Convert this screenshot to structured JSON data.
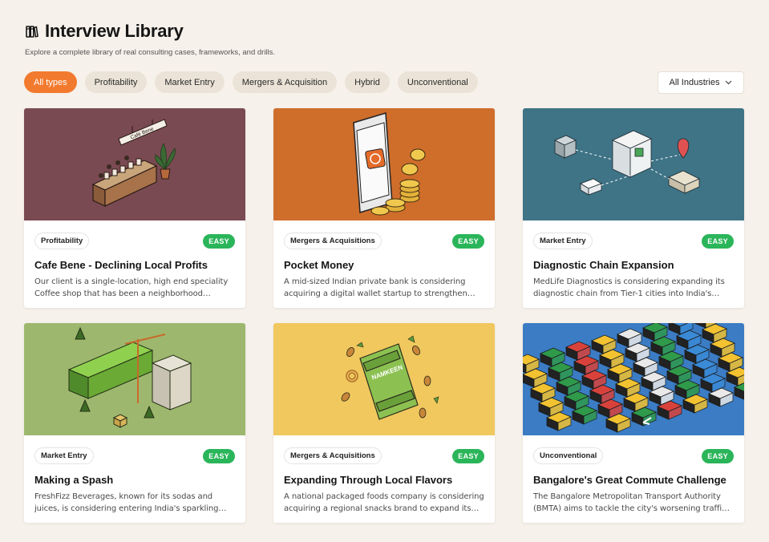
{
  "header": {
    "title": "Interview Library",
    "subtitle": "Explore a complete library of real consulting cases, frameworks, and drills.",
    "icon": "books-icon"
  },
  "filters": [
    {
      "label": "All types",
      "active": true
    },
    {
      "label": "Profitability",
      "active": false
    },
    {
      "label": "Market Entry",
      "active": false
    },
    {
      "label": "Mergers & Acquisition",
      "active": false
    },
    {
      "label": "Hybrid",
      "active": false
    },
    {
      "label": "Unconventional",
      "active": false
    }
  ],
  "industry_select": {
    "label": "All Industries",
    "icon": "chevron-down-icon"
  },
  "cards": [
    {
      "tag": "Profitability",
      "difficulty": "EASY",
      "title": "Cafe Bene - Declining Local Profits",
      "desc": "Our client is a single-location, high end speciality Coffee shop that has been a neighborhood bestsell...",
      "image_bg": "#7a4a52",
      "sign_text": "Café Bene"
    },
    {
      "tag": "Mergers & Acquisitions",
      "difficulty": "EASY",
      "title": "Pocket Money",
      "desc": "A mid-sized Indian private bank is considering acquiring a digital wallet startup to strengthen its...",
      "image_bg": "#cf6d2b"
    },
    {
      "tag": "Market Entry",
      "difficulty": "EASY",
      "title": "Diagnostic Chain Expansion",
      "desc": "MedLife Diagnostics is considering expanding its diagnostic chain from Tier-1 cities into India's emer...",
      "image_bg": "#3f7386"
    },
    {
      "tag": "Market Entry",
      "difficulty": "EASY",
      "title": "Making a Spash",
      "desc": "FreshFizz Beverages, known for its sodas and juices, is considering entering India's sparkling water ma...",
      "image_bg": "#9db86e"
    },
    {
      "tag": "Mergers & Acquisitions",
      "difficulty": "EASY",
      "title": "Expanding Through Local Flavors",
      "desc": "A national packaged foods company is considering acquiring a regional snacks brand to expand its pr...",
      "image_bg": "#f0c85e",
      "pack_text": "NAMKEEN"
    },
    {
      "tag": "Unconventional",
      "difficulty": "EASY",
      "title": "Bangalore's Great Commute Challenge",
      "desc": "The Bangalore Metropolitan Transport Authority (BMTA) aims to tackle the city's worsening traffic c...",
      "image_bg": "#3b7cc4"
    }
  ]
}
